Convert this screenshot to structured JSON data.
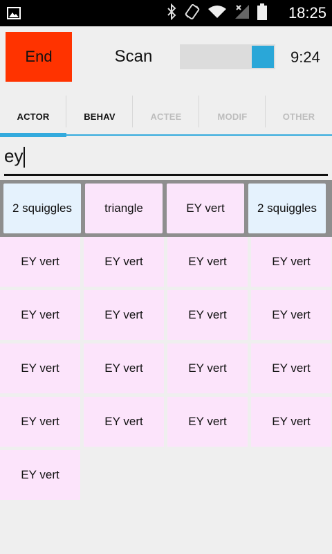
{
  "status_bar": {
    "time": "18:25",
    "icons": [
      "image-icon",
      "bluetooth-icon",
      "vibrate-icon",
      "wifi-icon",
      "signal-icon",
      "battery-icon"
    ]
  },
  "controls": {
    "end_label": "End",
    "scan_label": "Scan",
    "timer": "9:24",
    "end_color": "#ff3300",
    "slider_color": "#2aa7d8"
  },
  "tabs": [
    {
      "label": "ACTOR",
      "active": true,
      "enabled": true
    },
    {
      "label": "BEHAV",
      "active": false,
      "enabled": true
    },
    {
      "label": "ACTEE",
      "active": false,
      "enabled": false
    },
    {
      "label": "MODIF",
      "active": false,
      "enabled": false
    },
    {
      "label": "OTHER",
      "active": false,
      "enabled": false
    }
  ],
  "search": {
    "value": "ey"
  },
  "selected_row": [
    {
      "label": "2 squiggles",
      "color": "#e5f2fd"
    },
    {
      "label": "triangle",
      "color": "#fbe5fb"
    },
    {
      "label": "EY vert",
      "color": "#fbe5fb"
    },
    {
      "label": "2 squiggles",
      "color": "#e5f2fd"
    }
  ],
  "grid": [
    [
      "EY vert",
      "EY vert",
      "EY vert",
      "EY vert"
    ],
    [
      "EY vert",
      "EY vert",
      "EY vert",
      "EY vert"
    ],
    [
      "EY vert",
      "EY vert",
      "EY vert",
      "EY vert"
    ],
    [
      "EY vert",
      "EY vert",
      "EY vert",
      "EY vert"
    ],
    [
      "EY vert"
    ]
  ]
}
